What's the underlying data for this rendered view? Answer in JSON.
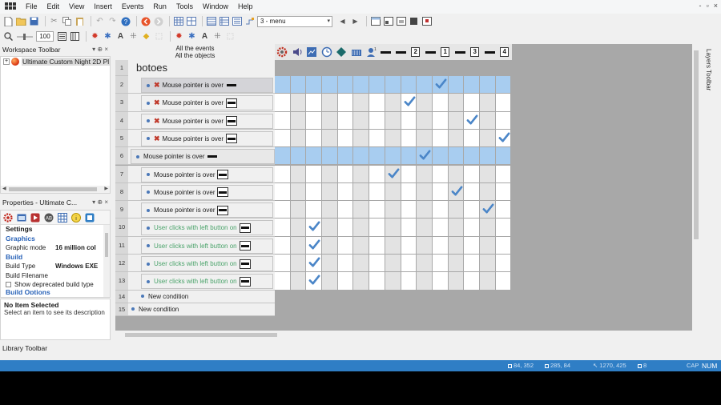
{
  "menu": [
    "File",
    "Edit",
    "View",
    "Insert",
    "Events",
    "Run",
    "Tools",
    "Window",
    "Help"
  ],
  "window_controls": [
    "-",
    "▫",
    "×"
  ],
  "toolbar": {
    "frame_combo": "3 - menu",
    "zoom": "100"
  },
  "workspace": {
    "title": "Workspace Toolbar",
    "item": "Ultimate Custom Night 2D Pl"
  },
  "properties": {
    "title": "Properties - Ultimate C...",
    "heading": "Settings",
    "categories": {
      "graphics": "Graphics",
      "build": "Build",
      "build_options": "Build Options"
    },
    "rows": [
      {
        "key": "Graphic mode",
        "value": "16 million col"
      },
      {
        "key": "Build Type",
        "value": "Windows EXE"
      },
      {
        "key": "Build Filename",
        "value": ""
      }
    ],
    "checkbox_label": "Show deprecated build type"
  },
  "description": {
    "title": "No Item Selected",
    "text": "Select an item to see its description"
  },
  "library_toolbar": "Library Toolbar",
  "layers_toolbar": "Layers Toolbar",
  "sheet": {
    "header_line1": "All the events",
    "header_line2": "All the objects",
    "group_title": "botoes",
    "object_columns": [
      "bar",
      "bar",
      "2",
      "bar",
      "1",
      "bar",
      "3",
      "bar",
      "4"
    ],
    "rows": [
      {
        "num": "2",
        "text": "Mouse pointer is over",
        "negated": true,
        "style": "normal",
        "highlight": true,
        "check": 10,
        "selected": true
      },
      {
        "num": "3",
        "text": "Mouse pointer is over",
        "negated": true,
        "style": "normal",
        "highlight": false,
        "check": 8
      },
      {
        "num": "4",
        "text": "Mouse pointer is over",
        "negated": true,
        "style": "normal",
        "highlight": false,
        "check": 12
      },
      {
        "num": "5",
        "text": "Mouse pointer is over",
        "negated": true,
        "style": "normal",
        "highlight": false,
        "check": 14
      },
      {
        "num": "6",
        "text": "Mouse pointer is over",
        "negated": false,
        "style": "normal",
        "highlight": true,
        "check": 9,
        "outdent": true
      },
      {
        "num": "7",
        "text": "Mouse pointer is over",
        "negated": false,
        "style": "normal",
        "highlight": false,
        "check": 7
      },
      {
        "num": "8",
        "text": "Mouse pointer is over",
        "negated": false,
        "style": "normal",
        "highlight": false,
        "check": 11
      },
      {
        "num": "9",
        "text": "Mouse pointer is over",
        "negated": false,
        "style": "normal",
        "highlight": false,
        "check": 13
      },
      {
        "num": "10",
        "text": "User clicks with left button on",
        "negated": false,
        "style": "green",
        "highlight": false,
        "check": 2
      },
      {
        "num": "11",
        "text": "User clicks with left button on",
        "negated": false,
        "style": "green",
        "highlight": false,
        "check": 2
      },
      {
        "num": "12",
        "text": "User clicks with left button on",
        "negated": false,
        "style": "green",
        "highlight": false,
        "check": 2
      },
      {
        "num": "13",
        "text": "User clicks with left button on",
        "negated": false,
        "style": "green",
        "highlight": false,
        "check": 2
      }
    ],
    "new_condition": [
      {
        "num": "14",
        "text": "New condition"
      },
      {
        "num": "15",
        "text": "New condition"
      }
    ]
  },
  "statusbar": {
    "cells": [
      "84, 352",
      "285, 84",
      "1270, 425",
      "8",
      "CAP"
    ],
    "num": "NUM"
  },
  "colors": {
    "accent": "#2f7ec5",
    "highlight": "#a8cdf0",
    "check": "#4b86c8"
  }
}
